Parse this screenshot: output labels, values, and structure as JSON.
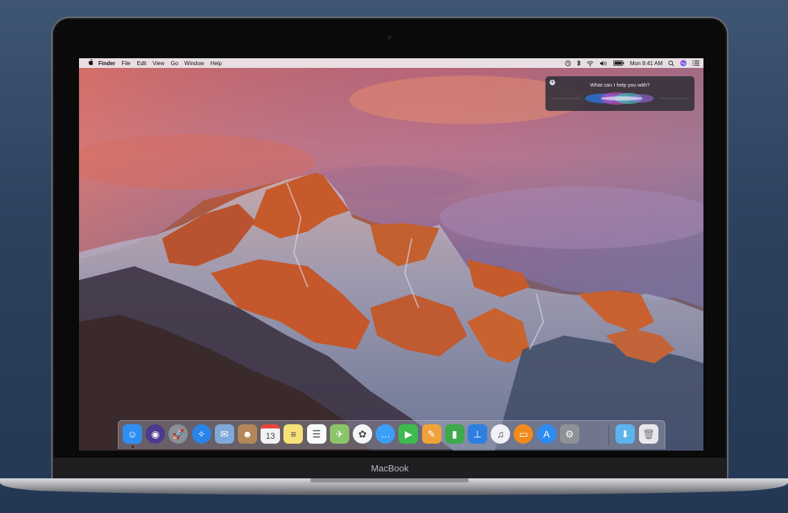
{
  "menubar": {
    "apple_glyph": "",
    "app_name": "Finder",
    "items": [
      "File",
      "Edit",
      "View",
      "Go",
      "Window",
      "Help"
    ],
    "clock": "Mon 9:41 AM",
    "status_icons": [
      "time-machine-icon",
      "bluetooth-icon",
      "wifi-icon",
      "volume-icon",
      "battery-icon",
      "spotlight-icon",
      "siri-icon",
      "notification-center-icon"
    ]
  },
  "siri": {
    "prompt": "What can I help you with?",
    "close_glyph": "×"
  },
  "dock": {
    "apps": [
      {
        "name": "finder-icon",
        "glyph": "☺",
        "color": "#2f8ff0",
        "running": true
      },
      {
        "name": "siri-icon",
        "glyph": "◉",
        "color": "#4b3a8f",
        "running": false
      },
      {
        "name": "launchpad-icon",
        "glyph": "🚀",
        "color": "#8a9097",
        "running": false
      },
      {
        "name": "safari-icon",
        "glyph": "✧",
        "color": "#2a83e6",
        "running": false
      },
      {
        "name": "mail-icon",
        "glyph": "✉",
        "color": "#7fa9d8",
        "running": false
      },
      {
        "name": "contacts-icon",
        "glyph": "☻",
        "color": "#b3875a",
        "running": false
      },
      {
        "name": "calendar-icon",
        "glyph": "13",
        "color": "#f2f2f2",
        "running": false
      },
      {
        "name": "notes-icon",
        "glyph": "≡",
        "color": "#f7e27a",
        "running": false
      },
      {
        "name": "reminders-icon",
        "glyph": "☰",
        "color": "#fafafa",
        "running": false
      },
      {
        "name": "maps-icon",
        "glyph": "✈",
        "color": "#8cc46a",
        "running": false
      },
      {
        "name": "photos-icon",
        "glyph": "✿",
        "color": "#f5f5f5",
        "running": false
      },
      {
        "name": "messages-icon",
        "glyph": "…",
        "color": "#3ba0f5",
        "running": false
      },
      {
        "name": "facetime-icon",
        "glyph": "▶",
        "color": "#3dbb4f",
        "running": false
      },
      {
        "name": "pages-icon",
        "glyph": "✎",
        "color": "#f0a33b",
        "running": false
      },
      {
        "name": "numbers-icon",
        "glyph": "▮",
        "color": "#3fa94d",
        "running": false
      },
      {
        "name": "keynote-icon",
        "glyph": "⊥",
        "color": "#2e7fe0",
        "running": false
      },
      {
        "name": "itunes-icon",
        "glyph": "♫",
        "color": "#f0f0f5",
        "running": false
      },
      {
        "name": "ibooks-icon",
        "glyph": "▭",
        "color": "#f18a1d",
        "running": false
      },
      {
        "name": "app-store-icon",
        "glyph": "A",
        "color": "#2d8cf0",
        "running": false
      },
      {
        "name": "system-preferences-icon",
        "glyph": "⚙",
        "color": "#8e9196",
        "running": false
      }
    ],
    "folders": [
      {
        "name": "downloads-folder-icon",
        "glyph": "⬇",
        "color": "#5bb4ea"
      },
      {
        "name": "trash-icon",
        "glyph": "🗑",
        "color": "#e8e8ec"
      }
    ]
  },
  "device": {
    "brand": "MacBook"
  }
}
